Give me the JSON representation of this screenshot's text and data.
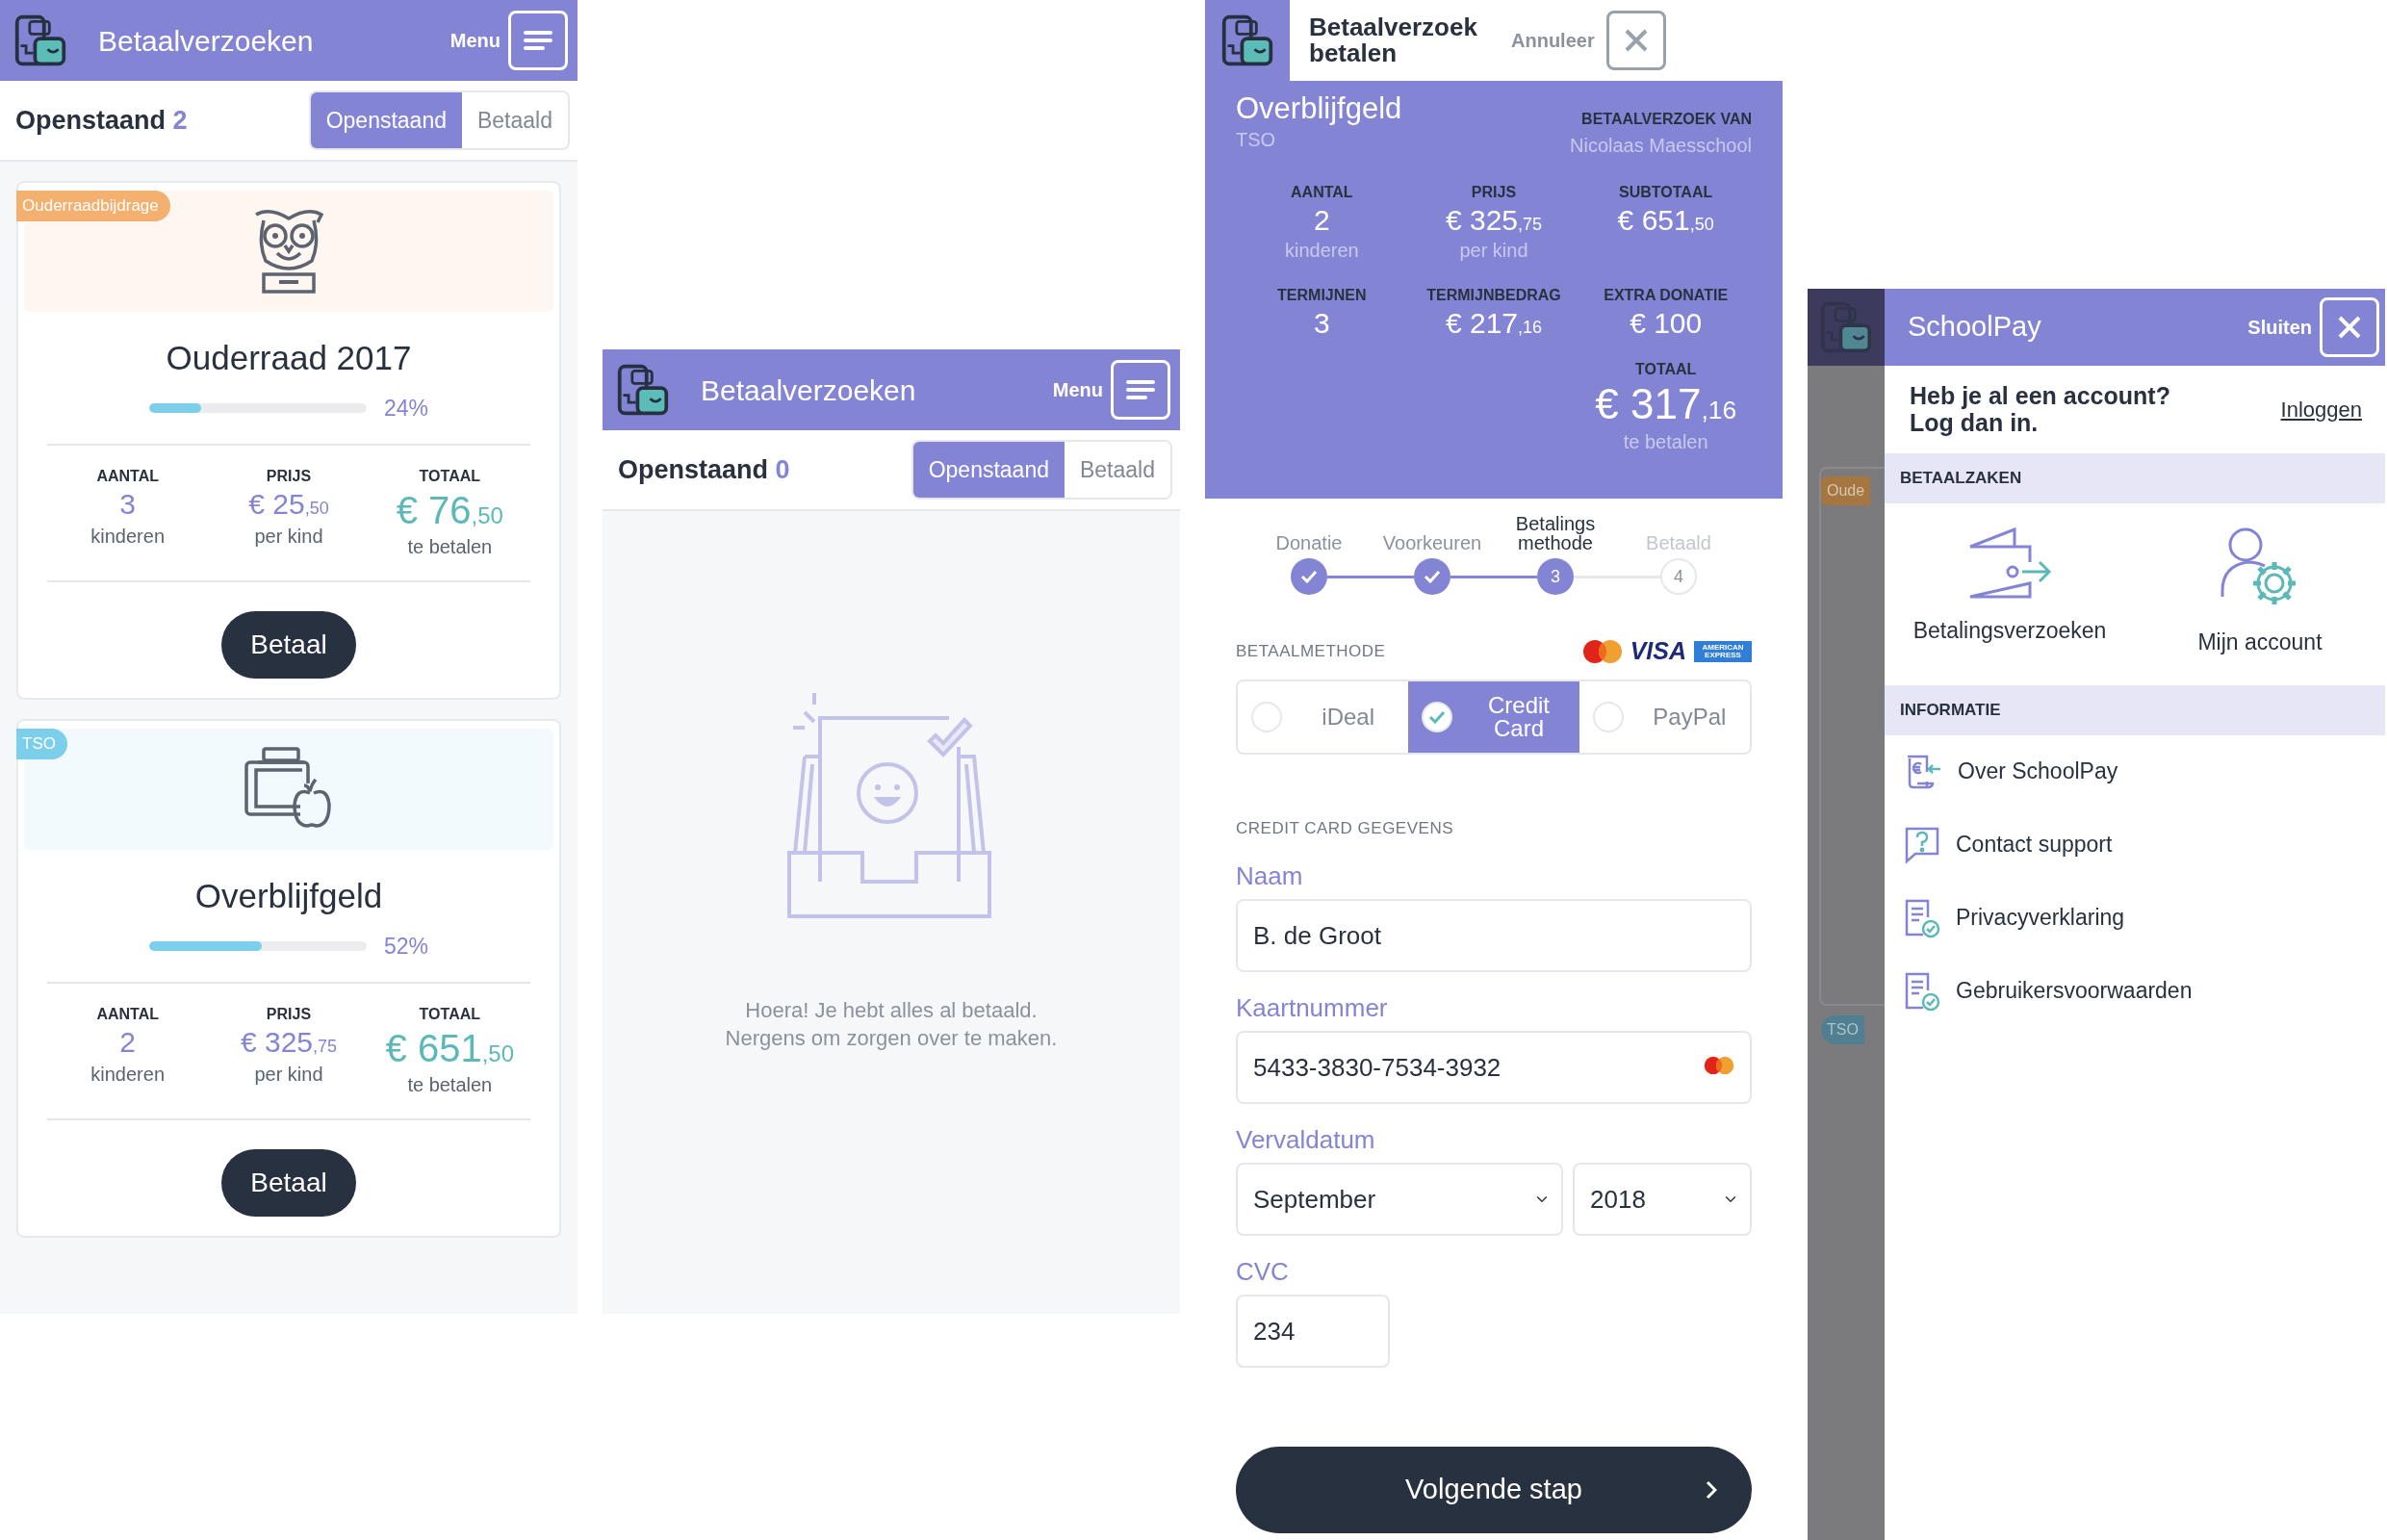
{
  "requests_list": {
    "header": {
      "title": "Betaalverzoeken",
      "menu_label": "Menu"
    },
    "subheader": {
      "heading": "Openstaand",
      "count": "2"
    },
    "tabs": [
      {
        "label": "Openstaand",
        "selected": true
      },
      {
        "label": "Betaald",
        "selected": false
      }
    ],
    "cards": [
      {
        "tag": "Ouderraadbijdrage",
        "color": "#f3b06f",
        "kind": "owl",
        "title": "Ouderraad 2017",
        "level": 0.24,
        "percent": "24%",
        "stats": [
          {
            "label": "AANTAL",
            "kind": "count",
            "whole": "3",
            "sub": "kinderen"
          },
          {
            "label": "PRIJS",
            "kind": "price",
            "whole": "€ 25",
            "cents": ",50",
            "sub": "per kind"
          },
          {
            "label": "TOTAAL",
            "kind": "total",
            "whole": "€ 76",
            "cents": ",50",
            "sub": "te betalen"
          }
        ],
        "button": "Betaal"
      },
      {
        "tag": "TSO",
        "color": "#7ccfea",
        "kind": "lunchbox",
        "title": "Overblijfgeld",
        "level": 0.52,
        "percent": "52%",
        "stats": [
          {
            "label": "AANTAL",
            "kind": "count",
            "whole": "2",
            "sub": "kinderen"
          },
          {
            "label": "PRIJS",
            "kind": "price",
            "whole": "€ 325",
            "cents": ",75",
            "sub": "per kind"
          },
          {
            "label": "TOTAAL",
            "kind": "total",
            "whole": "€ 651",
            "cents": ",50",
            "sub": "te betalen"
          }
        ],
        "button": "Betaal"
      }
    ]
  },
  "requests_empty": {
    "header": {
      "title": "Betaalverzoeken",
      "menu_label": "Menu"
    },
    "subheader": {
      "heading": "Openstaand",
      "count": "0"
    },
    "tabs": [
      {
        "label": "Openstaand",
        "selected": true
      },
      {
        "label": "Betaald",
        "selected": false
      }
    ],
    "message": [
      "Hoera! Je hebt alles al betaald.",
      "Nergens om zorgen over te maken."
    ]
  },
  "payment": {
    "header": {
      "title": "Betaalverzoek betalen",
      "cancel_label": "Annuleer"
    },
    "summary": {
      "title": "Overblijfgeld",
      "category": "TSO",
      "from_label": "BETAALVERZOEK VAN",
      "from": "Nicolaas Maesschool",
      "stats": [
        {
          "label": "AANTAL",
          "whole": "2",
          "sub": "kinderen"
        },
        {
          "label": "PRIJS",
          "whole": "€ 325",
          "cents": ",75",
          "sub": "per kind"
        },
        {
          "label": "SUBTOTAAL",
          "whole": "€ 651",
          "cents": ",50"
        },
        {
          "label": "TERMIJNEN",
          "whole": "3"
        },
        {
          "label": "TERMIJNBEDRAG",
          "whole": "€ 217",
          "cents": ",16"
        },
        {
          "label": "EXTRA DONATIE",
          "whole": "€ 100"
        }
      ],
      "total": {
        "label": "TOTAAL",
        "whole": "€ 317",
        "cents": ",16",
        "sub": "te betalen"
      }
    },
    "steps": [
      {
        "label": "Donatie",
        "done": true,
        "current": false
      },
      {
        "label": "Voorkeuren",
        "done": true,
        "current": false
      },
      {
        "label": "Betalings methode",
        "done": false,
        "current": true,
        "number": "3"
      },
      {
        "label": "Betaald",
        "done": false,
        "current": false,
        "number": "4"
      }
    ],
    "method_label": "BETAALMETHODE",
    "card_logos": [
      {
        "kind": "mastercard"
      },
      {
        "kind": "visa",
        "text": "VISA"
      },
      {
        "kind": "amex",
        "text": "AMERICAN EXPRESS"
      }
    ],
    "methods": [
      {
        "label": "iDeal",
        "selected": false
      },
      {
        "label": "Credit Card",
        "selected": true
      },
      {
        "label": "PayPal",
        "selected": false
      }
    ],
    "details_label": "CREDIT CARD GEGEVENS",
    "fields": [
      {
        "label": "Naam",
        "kind": "text",
        "value": "B. de Groot"
      },
      {
        "label": "Kaartnummer",
        "kind": "card",
        "value": "5433-3830-7534-3932"
      },
      {
        "label": "Vervaldatum",
        "kind": "expiry",
        "values": [
          "September",
          "2018"
        ]
      },
      {
        "label": "CVC",
        "kind": "short",
        "value": "234"
      }
    ],
    "button": "Volgende stap"
  },
  "menu": {
    "backdrop": [
      {
        "label": "Oude",
        "color": "#a5763f"
      },
      {
        "label": "TSO",
        "color": "#4f7f90"
      }
    ],
    "header": {
      "title": "SchoolPay",
      "close_label": "Sluiten"
    },
    "login": {
      "prompt": "Heb je al een account? Log dan in.",
      "link": "Inloggen"
    },
    "sections": [
      {
        "title": "BETAALZAKEN",
        "kind": "tiles",
        "items": [
          {
            "label": "Betalingsverzoeken",
            "kind": "wallet"
          },
          {
            "label": "Mijn account",
            "kind": "user"
          }
        ]
      },
      {
        "title": "INFORMATIE",
        "kind": "list",
        "items": [
          {
            "label": "Over SchoolPay",
            "kind": "receipt"
          },
          {
            "label": "Contact support",
            "kind": "question"
          },
          {
            "label": "Privacyverklaring",
            "kind": "document"
          },
          {
            "label": "Gebruikersvoorwaarden",
            "kind": "document"
          }
        ]
      }
    ]
  }
}
